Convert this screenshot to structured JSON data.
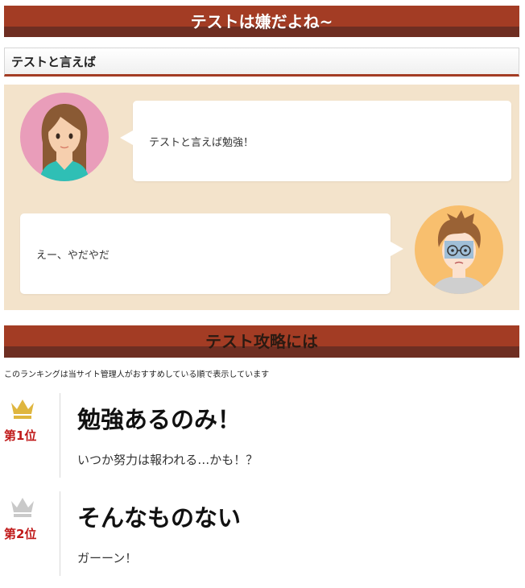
{
  "header": {
    "title": "テストは嫌だよね~"
  },
  "subheading": {
    "text": "テストと言えば"
  },
  "chat": {
    "messages": [
      {
        "speaker_icon": "woman-avatar",
        "text": "テストと言えば勉強！"
      },
      {
        "speaker_icon": "boy-avatar",
        "text": "えー、やだやだ"
      }
    ]
  },
  "section": {
    "title": "テスト攻略には",
    "note": "このランキングは当サイト管理人がおすすめしている順で表示しています"
  },
  "ranking": [
    {
      "rank_label": "第1位",
      "crown_icon": "gold-crown-icon",
      "crown_color": "#dfb63f",
      "title": "勉強あるのみ！",
      "text": "いつか努力は報われる…かも！？"
    },
    {
      "rank_label": "第2位",
      "crown_icon": "silver-crown-icon",
      "crown_color": "#c9c9c9",
      "title": "そんなものない",
      "text": "ガーーン！"
    }
  ],
  "colors": {
    "banner": "#a33c24",
    "banner_dark": "#6e2e22",
    "chat_bg": "#f3e3cb",
    "rank_label": "#c01a1a"
  }
}
